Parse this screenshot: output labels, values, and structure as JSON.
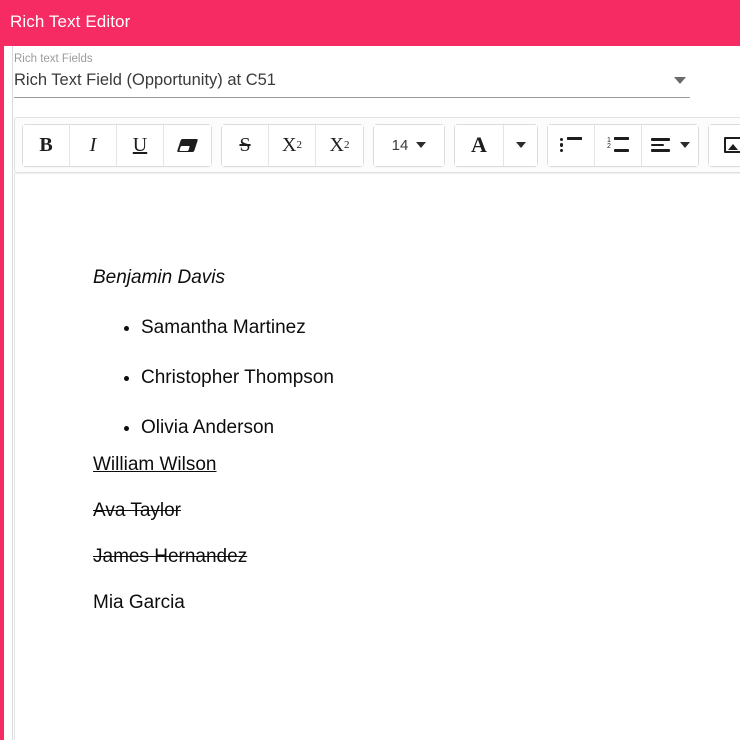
{
  "header": {
    "title": "Rich Text Editor",
    "background_color": "#f72b63",
    "text_color": "#ffffff"
  },
  "field_selector": {
    "label": "Rich text Fields",
    "value": "Rich Text Field (Opportunity) at C51",
    "caret_icon": "chevron-down-icon"
  },
  "toolbar": {
    "groups": [
      {
        "name": "text-style-group",
        "buttons": [
          {
            "name": "bold-button",
            "glyph": "B",
            "icon": "bold-icon"
          },
          {
            "name": "italic-button",
            "glyph": "I",
            "icon": "italic-icon"
          },
          {
            "name": "underline-button",
            "glyph": "U",
            "icon": "underline-icon"
          },
          {
            "name": "remove-format-button",
            "glyph": "",
            "icon": "eraser-icon"
          }
        ]
      },
      {
        "name": "script-group",
        "buttons": [
          {
            "name": "strikethrough-button",
            "glyph": "S",
            "icon": "strikethrough-icon"
          },
          {
            "name": "superscript-button",
            "glyph": "X",
            "sup": "2",
            "icon": "superscript-icon"
          },
          {
            "name": "subscript-button",
            "glyph": "X",
            "sub": "2",
            "icon": "subscript-icon"
          }
        ]
      },
      {
        "name": "font-size-group",
        "buttons": [
          {
            "name": "font-size-dropdown",
            "glyph": "14",
            "icon": "chevron-down-icon"
          }
        ]
      },
      {
        "name": "text-color-group",
        "buttons": [
          {
            "name": "text-color-button",
            "glyph": "A",
            "icon": "font-color-icon"
          },
          {
            "name": "text-color-dropdown",
            "glyph": "",
            "icon": "chevron-down-icon"
          }
        ]
      },
      {
        "name": "list-group",
        "buttons": [
          {
            "name": "bulleted-list-button",
            "glyph": "",
            "icon": "bulleted-list-icon"
          },
          {
            "name": "numbered-list-button",
            "glyph": "",
            "icon": "numbered-list-icon",
            "marker_1": "1",
            "marker_2": "2"
          },
          {
            "name": "align-dropdown",
            "glyph": "",
            "icon": "align-left-icon"
          }
        ]
      },
      {
        "name": "insert-group",
        "buttons": [
          {
            "name": "insert-image-button",
            "glyph": "",
            "icon": "image-icon"
          }
        ]
      }
    ],
    "font_size_value": "14"
  },
  "document": {
    "heading": "Benjamin Davis",
    "bullet_items": [
      "Samantha Martinez",
      "Christopher Thompson",
      "Olivia Anderson"
    ],
    "link_line": "William Wilson",
    "strike_lines": [
      "Ava Taylor",
      "James Hernandez"
    ],
    "plain_line": "Mia Garcia",
    "link_color": "#1f6cb0",
    "text_color": "#0d0d0d"
  }
}
